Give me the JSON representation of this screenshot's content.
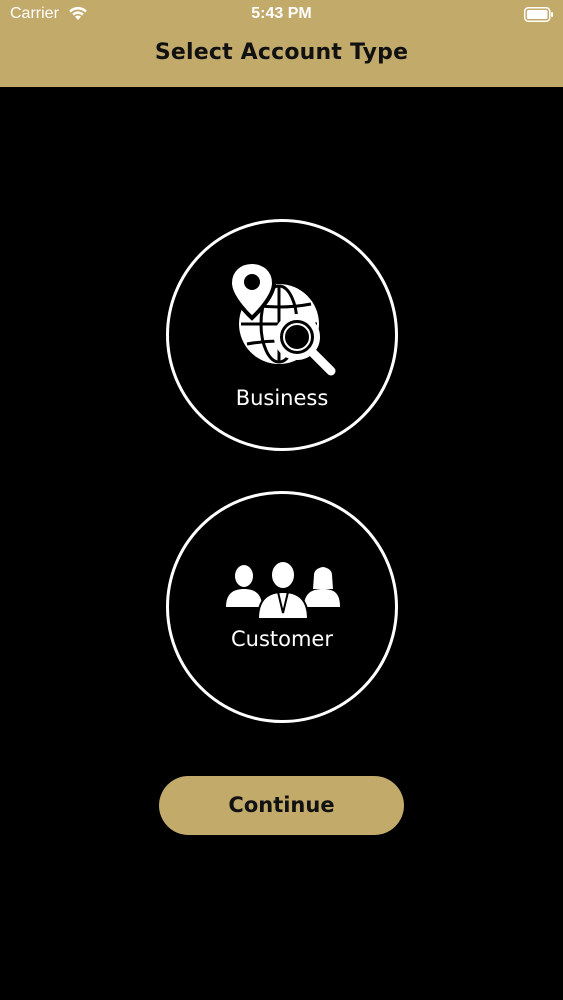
{
  "status_bar": {
    "carrier": "Carrier",
    "time": "5:43 PM",
    "wifi_icon": "wifi-icon",
    "battery_icon": "battery-icon"
  },
  "header": {
    "title": "Select Account Type",
    "background_color": "#c2aa6b"
  },
  "account_types": [
    {
      "label": "Business",
      "icon": "globe-search-pin-icon"
    },
    {
      "label": "Customer",
      "icon": "people-group-icon"
    }
  ],
  "continue_button": {
    "label": "Continue",
    "color": "#c2aa6b"
  },
  "colors": {
    "background": "#000000",
    "accent": "#c2aa6b",
    "circle_border": "#ffffff"
  }
}
